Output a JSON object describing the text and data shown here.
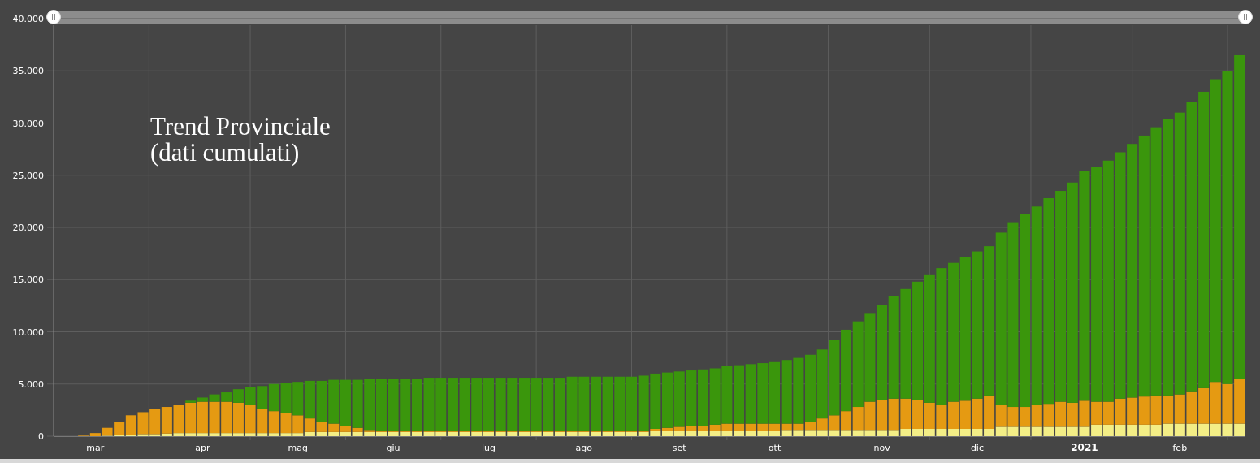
{
  "range_slider": {
    "handles": [
      {
        "level": 0
      },
      {
        "level": 1
      }
    ]
  },
  "chart_data": {
    "type": "bar",
    "stacked": true,
    "grid": true,
    "title": "Trend Provinciale\n(dati cumulati)",
    "categories": [
      null,
      null,
      null,
      "mar",
      null,
      null,
      null,
      null,
      null,
      null,
      null,
      null,
      "apr",
      null,
      null,
      null,
      null,
      null,
      null,
      null,
      "mag",
      null,
      null,
      null,
      null,
      null,
      null,
      null,
      "giu",
      null,
      null,
      null,
      null,
      null,
      null,
      null,
      "lug",
      null,
      null,
      null,
      null,
      null,
      null,
      null,
      "ago",
      null,
      null,
      null,
      null,
      null,
      null,
      null,
      "set",
      null,
      null,
      null,
      null,
      null,
      null,
      null,
      "ott",
      null,
      null,
      null,
      null,
      null,
      null,
      null,
      null,
      "nov",
      null,
      null,
      null,
      null,
      null,
      null,
      null,
      "dic",
      null,
      null,
      null,
      null,
      null,
      null,
      null,
      null,
      "2021",
      null,
      null,
      null,
      null,
      null,
      null,
      null,
      "feb",
      null,
      null,
      null,
      null,
      null
    ],
    "ylim": [
      0,
      40000
    ],
    "yticks": [
      {
        "value": 0,
        "label": "0"
      },
      {
        "value": 5000,
        "label": "5.000"
      },
      {
        "value": 10000,
        "label": "10.000"
      },
      {
        "value": 15000,
        "label": "15.000"
      },
      {
        "value": 20000,
        "label": "20.000"
      },
      {
        "value": 25000,
        "label": "25.000"
      },
      {
        "value": 30000,
        "label": "30.000"
      },
      {
        "value": 35000,
        "label": "35.000"
      },
      {
        "value": 40000,
        "label": "40.000"
      }
    ],
    "series": [
      {
        "color": "#f3ee86",
        "values": [
          0,
          0,
          0,
          0,
          50,
          100,
          150,
          200,
          200,
          250,
          300,
          300,
          300,
          300,
          300,
          300,
          300,
          300,
          300,
          300,
          300,
          400,
          400,
          400,
          400,
          400,
          400,
          400,
          400,
          400,
          400,
          400,
          400,
          400,
          400,
          400,
          400,
          400,
          400,
          400,
          400,
          400,
          400,
          400,
          400,
          400,
          400,
          400,
          400,
          400,
          500,
          500,
          500,
          500,
          500,
          500,
          500,
          500,
          500,
          500,
          500,
          600,
          600,
          600,
          600,
          600,
          600,
          600,
          600,
          600,
          600,
          700,
          700,
          700,
          700,
          700,
          700,
          700,
          700,
          900,
          900,
          900,
          900,
          900,
          900,
          900,
          900,
          1100,
          1100,
          1100,
          1100,
          1100,
          1100,
          1200,
          1200,
          1200,
          1200,
          1200,
          1200,
          1200
        ]
      },
      {
        "color": "#e59a12",
        "values": [
          0,
          0,
          50,
          300,
          750,
          1300,
          1850,
          2100,
          2400,
          2550,
          2700,
          2900,
          3000,
          3000,
          3000,
          2900,
          2700,
          2300,
          2100,
          1900,
          1700,
          1300,
          1000,
          800,
          600,
          400,
          200,
          100,
          100,
          100,
          100,
          100,
          100,
          100,
          100,
          100,
          100,
          100,
          100,
          100,
          100,
          100,
          100,
          100,
          100,
          100,
          100,
          100,
          100,
          100,
          200,
          300,
          400,
          500,
          500,
          600,
          700,
          700,
          700,
          700,
          700,
          600,
          600,
          800,
          1100,
          1400,
          1800,
          2200,
          2700,
          2900,
          3000,
          2900,
          2800,
          2500,
          2300,
          2600,
          2700,
          2900,
          3200,
          2100,
          1900,
          1900,
          2100,
          2200,
          2400,
          2300,
          2500,
          2200,
          2200,
          2500,
          2600,
          2700,
          2800,
          2700,
          2800,
          3100,
          3400,
          4000,
          3800,
          4300
        ]
      },
      {
        "color": "#3a960c",
        "values": [
          0,
          0,
          0,
          0,
          0,
          0,
          0,
          0,
          0,
          0,
          null,
          200,
          400,
          700,
          900,
          1300,
          1700,
          2200,
          2600,
          2900,
          3200,
          3600,
          3900,
          4200,
          4400,
          4600,
          4900,
          5000,
          5000,
          5000,
          5000,
          5100,
          5100,
          5100,
          5100,
          5100,
          5100,
          5100,
          5100,
          5100,
          5100,
          5100,
          5100,
          5200,
          5200,
          5200,
          5200,
          5200,
          5200,
          5300,
          5300,
          5300,
          5300,
          5300,
          5400,
          5400,
          5500,
          5600,
          5700,
          5800,
          5900,
          6100,
          6300,
          6400,
          6600,
          7200,
          7800,
          8200,
          8500,
          9100,
          9800,
          10500,
          11300,
          12300,
          13100,
          13300,
          13800,
          14100,
          14300,
          16500,
          17700,
          18500,
          19000,
          19700,
          20200,
          21100,
          22000,
          22500,
          23100,
          23600,
          24300,
          25000,
          25700,
          26500,
          27000,
          27700,
          28400,
          29000,
          30000,
          31000
        ]
      }
    ]
  }
}
